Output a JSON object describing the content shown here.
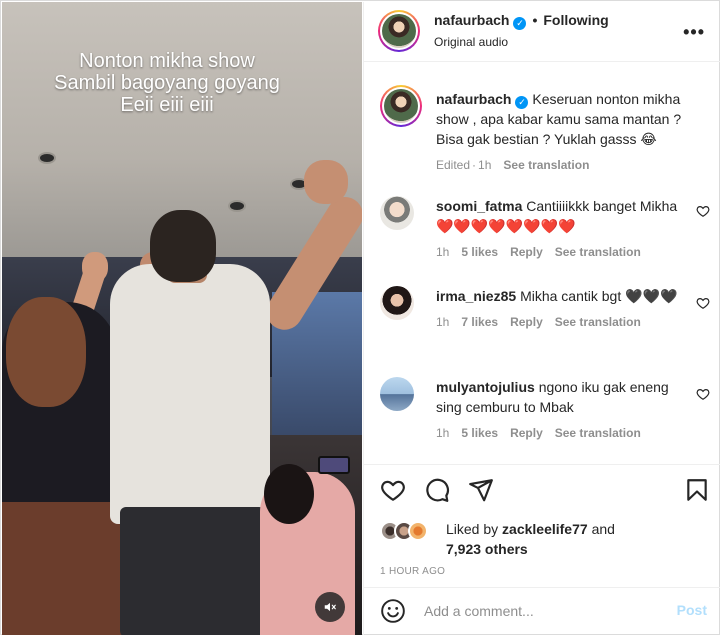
{
  "media": {
    "overlay_lines": [
      "Nonton mikha show",
      "Sambil bagoyang goyang",
      "Eeii eiii eiii"
    ],
    "mute_icon": "speaker-muted-icon"
  },
  "header": {
    "username": "nafaurbach",
    "separator": "•",
    "following_label": "Following",
    "audio_label": "Original audio",
    "more_icon": "•••"
  },
  "caption": {
    "username": "nafaurbach",
    "text": "Keseruan nonton mikha show , apa kabar kamu sama mantan ? Bisa gak bestian ? Yuklah gasss 😂",
    "edited": "Edited",
    "time": "1h",
    "see_translation": "See translation"
  },
  "comments": [
    {
      "username": "soomi_fatma",
      "text": "Cantiiiikkk banget Mikha ❤️❤️❤️❤️❤️❤️❤️❤️",
      "time": "1h",
      "likes": "5 likes",
      "reply": "Reply",
      "see_translation": "See translation"
    },
    {
      "username": "irma_niez85",
      "text": "Mikha cantik bgt 🖤🖤🖤",
      "time": "1h",
      "likes": "7 likes",
      "reply": "Reply",
      "see_translation": "See translation"
    },
    {
      "username": "mulyantojulius",
      "text": "ngono iku gak eneng sing cemburu to Mbak",
      "time": "1h",
      "likes": "5 likes",
      "reply": "Reply",
      "see_translation": "See translation"
    }
  ],
  "likes": {
    "prefix": "Liked by",
    "user": "zackleelife77",
    "conjunction": "and",
    "count": "7,923 others"
  },
  "time_ago": "1 HOUR AGO",
  "comment_box": {
    "placeholder": "Add a comment...",
    "post_label": "Post"
  },
  "colors": {
    "accent": "#0095f6",
    "post_disabled": "#b2dffc",
    "muted_text": "#8e8e8e",
    "heart_red": "#ed4956"
  }
}
